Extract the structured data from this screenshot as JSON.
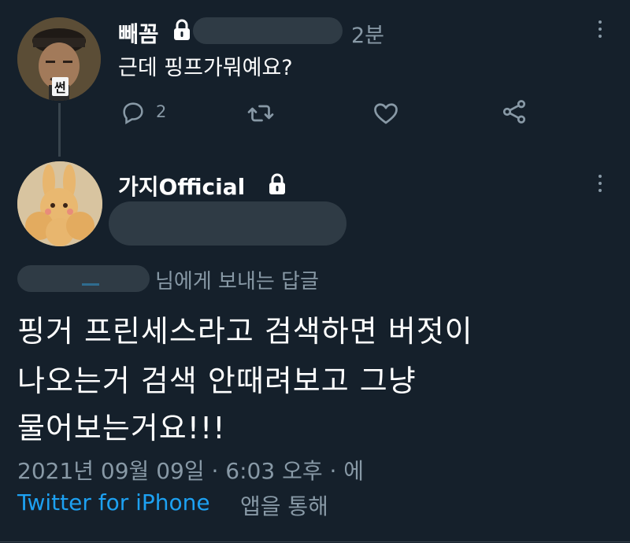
{
  "colors": {
    "background": "#15202b",
    "text_primary": "#ffffff",
    "text_secondary": "#8899a6",
    "link": "#1da1f2",
    "redaction": "#2f3b45"
  },
  "parent_tweet": {
    "avatar_badge": "썬",
    "display_name": "빼꼼",
    "protected_icon": "lock-icon",
    "time_ago": "2분",
    "text": "근데 핑프가뭐예요?",
    "actions": {
      "reply_icon": "reply-icon",
      "reply_count": "2",
      "retweet_icon": "retweet-icon",
      "like_icon": "heart-icon",
      "share_icon": "share-icon"
    },
    "menu_icon": "more-vertical-icon"
  },
  "main_tweet": {
    "display_name": "가지Official",
    "protected_icon": "lock-icon",
    "menu_icon": "more-vertical-icon",
    "replying_to_suffix": "님에게 보내는 답글",
    "body_lines": [
      "핑거 프린세스라고 검색하면 버젓이",
      "나오는거 검색 안때려보고 그냥",
      "물어보는거요!!!"
    ],
    "timestamp": "2021년 09월 09일 · 6:03 오후 · 에",
    "source_app": "Twitter for iPhone",
    "source_suffix": "앱을 통해"
  }
}
